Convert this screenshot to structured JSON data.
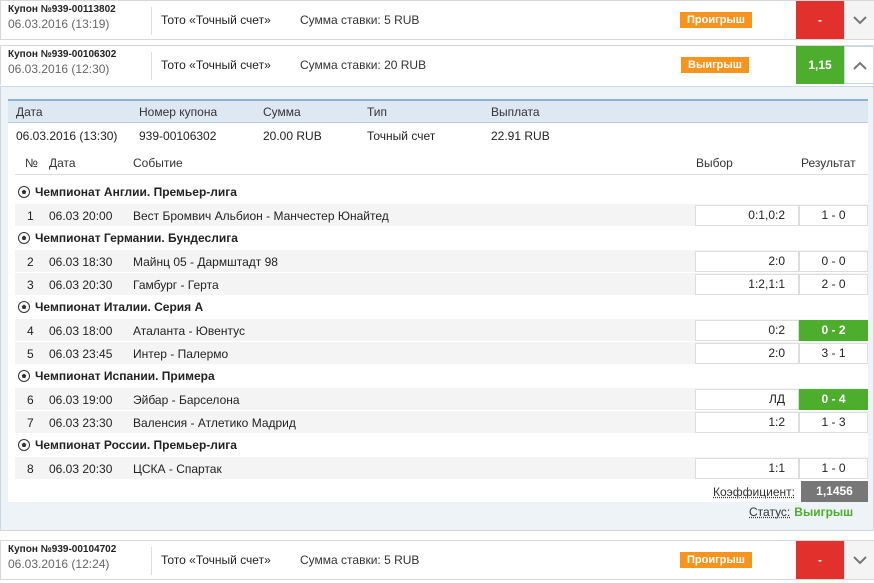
{
  "coupons": [
    {
      "id": "Купон №939-00113802",
      "date": "06.03.2016 (13:19)",
      "type": "Тото «Точный счет»",
      "stake": "Сумма ставки: 5 RUB",
      "status": "Проигрыш",
      "coef": "-",
      "status_color": "#f7941d",
      "coef_color": "#e2302c"
    },
    {
      "id": "Купон №939-00106302",
      "date": "06.03.2016 (12:30)",
      "type": "Тото «Точный счет»",
      "stake": "Сумма ставки: 20 RUB",
      "status": "Выигрыш",
      "coef": "1,15",
      "status_color": "#f7941d",
      "coef_color": "#4cae2c"
    },
    {
      "id": "Купон №939-00104702",
      "date": "06.03.2016 (12:24)",
      "type": "Тото «Точный счет»",
      "stake": "Сумма ставки: 5 RUB",
      "status": "Проигрыш",
      "coef": "-",
      "status_color": "#f7941d",
      "coef_color": "#e2302c"
    }
  ],
  "summary": {
    "headers": [
      "Дата",
      "Номер купона",
      "Сумма",
      "Тип",
      "Выплата"
    ],
    "values": [
      "06.03.2016 (13:30)",
      "939-00106302",
      "20.00 RUB",
      "Точный счет",
      "22.91 RUB"
    ]
  },
  "events_header": [
    "№",
    "Дата",
    "Событие",
    "Выбор",
    "Результат"
  ],
  "leagues": [
    "Чемпионат Англии. Премьер-лига",
    "Чемпионат Германии. Бундеслига",
    "Чемпионат Италии. Серия А",
    "Чемпионат Испании. Примера",
    "Чемпионат России. Премьер-лига"
  ],
  "events": [
    {
      "n": "1",
      "date": "06.03 20:00",
      "match": "Вест Бромвич Альбион - Манчестер Юнайтед",
      "pick": "0:1,0:2",
      "result": "1 - 0",
      "win": false
    },
    {
      "n": "2",
      "date": "06.03 18:30",
      "match": "Майнц 05 - Дармштадт 98",
      "pick": "2:0",
      "result": "0 - 0",
      "win": false
    },
    {
      "n": "3",
      "date": "06.03 20:30",
      "match": "Гамбург - Герта",
      "pick": "1:2,1:1",
      "result": "2 - 0",
      "win": false
    },
    {
      "n": "4",
      "date": "06.03 18:00",
      "match": "Аталанта - Ювентус",
      "pick": "0:2",
      "result": "0 - 2",
      "win": true
    },
    {
      "n": "5",
      "date": "06.03 23:45",
      "match": "Интер - Палермо",
      "pick": "2:0",
      "result": "3 - 1",
      "win": false
    },
    {
      "n": "6",
      "date": "06.03 19:00",
      "match": "Эйбар - Барселона",
      "pick": "ЛД",
      "result": "0 - 4",
      "win": true
    },
    {
      "n": "7",
      "date": "06.03 23:30",
      "match": "Валенсия - Атлетико Мадрид",
      "pick": "1:2",
      "result": "1 - 3",
      "win": false
    },
    {
      "n": "8",
      "date": "06.03 20:30",
      "match": "ЦСКА - Спартак",
      "pick": "1:1",
      "result": "1 - 0",
      "win": false
    }
  ],
  "coefficient": {
    "label": "Коэффициент:",
    "value": "1,1456"
  },
  "status": {
    "label": "Статус:",
    "value": "Выигрыш"
  },
  "icons": {
    "league": "soccer-ball-icon",
    "collapse": "chevron-up-icon",
    "expand": "chevron-down-icon"
  }
}
